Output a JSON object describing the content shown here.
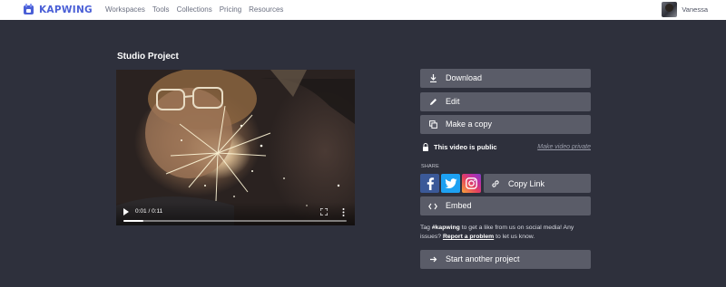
{
  "brand": {
    "name": "KAPWING",
    "color": "#4a5fd6"
  },
  "nav": {
    "items": [
      "Workspaces",
      "Tools",
      "Collections",
      "Pricing",
      "Resources"
    ]
  },
  "user": {
    "name": "Vanessa"
  },
  "page": {
    "title": "Studio Project"
  },
  "video": {
    "time": "0:01 / 0:11",
    "progress": 0.09
  },
  "actions": {
    "download": "Download",
    "edit": "Edit",
    "make_copy": "Make a copy",
    "embed": "Embed",
    "start_another": "Start another project"
  },
  "visibility": {
    "status": "This video is public",
    "toggle_link": "Make video private"
  },
  "share": {
    "label": "SHARE",
    "copy_link": "Copy Link",
    "networks": [
      "facebook",
      "twitter",
      "instagram"
    ]
  },
  "tag_message": {
    "prefix": "Tag ",
    "hashtag": "#kapwing",
    "middle": " to get a like from us on social media! Any issues? ",
    "report_link": "Report a problem",
    "suffix": " to let us know."
  },
  "colors": {
    "background": "#2e303c",
    "button": "#5a5c68",
    "facebook": "#3b5998",
    "twitter": "#1da1f2"
  }
}
